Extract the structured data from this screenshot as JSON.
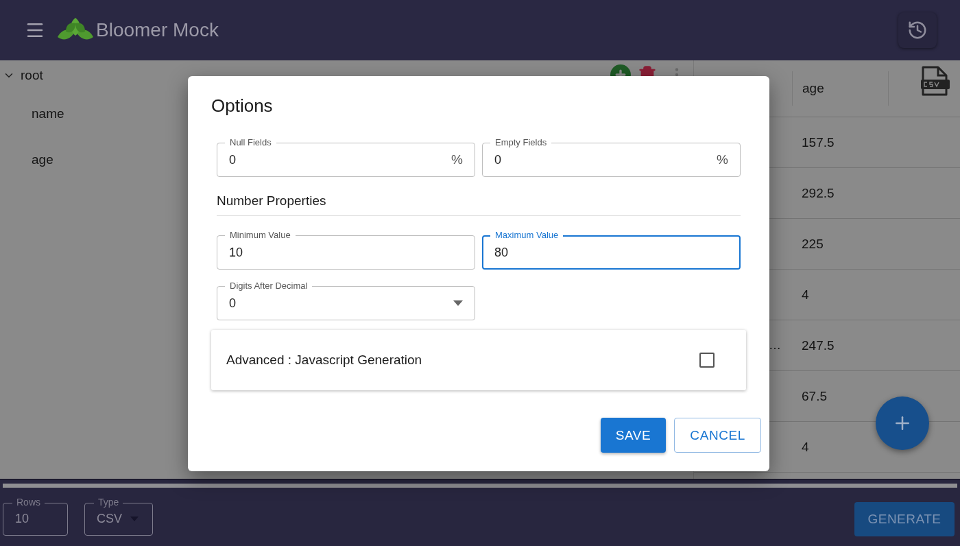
{
  "app": {
    "title": "Bloomer Mock"
  },
  "tree": {
    "label": "root",
    "expanded": true,
    "children": [
      {
        "label": "name"
      },
      {
        "label": "age"
      }
    ]
  },
  "table": {
    "columns": [
      "age"
    ],
    "rows": [
      {
        "age": "157.5"
      },
      {
        "age": "292.5"
      },
      {
        "age": "225"
      },
      {
        "age": "4"
      },
      {
        "name": "…",
        "age": "247.5"
      },
      {
        "age": "67.5"
      },
      {
        "age": "4"
      }
    ]
  },
  "dialog": {
    "title": "Options",
    "fields": [
      {
        "label": "Null Fields",
        "value": "0",
        "suffix": "%",
        "focused": false
      },
      {
        "label": "Empty Fields",
        "value": "0",
        "suffix": "%",
        "focused": false
      }
    ],
    "section": "Number Properties",
    "number_fields": [
      {
        "label": "Minimum Value",
        "value": "10",
        "focused": false
      },
      {
        "label": "Maximum Value",
        "value": "80",
        "focused": true
      }
    ],
    "select": {
      "label": "Digits After Decimal",
      "value": "0"
    },
    "advanced": {
      "label": "Advanced : Javascript Generation",
      "checked": false
    },
    "buttons": [
      {
        "label": "SAVE",
        "kind": "primary"
      },
      {
        "label": "CANCEL",
        "kind": "outlined"
      }
    ]
  },
  "footer": {
    "rows": {
      "label": "Rows",
      "value": "10"
    },
    "type": {
      "label": "Type",
      "value": "CSV"
    },
    "generate": "GENERATE"
  }
}
